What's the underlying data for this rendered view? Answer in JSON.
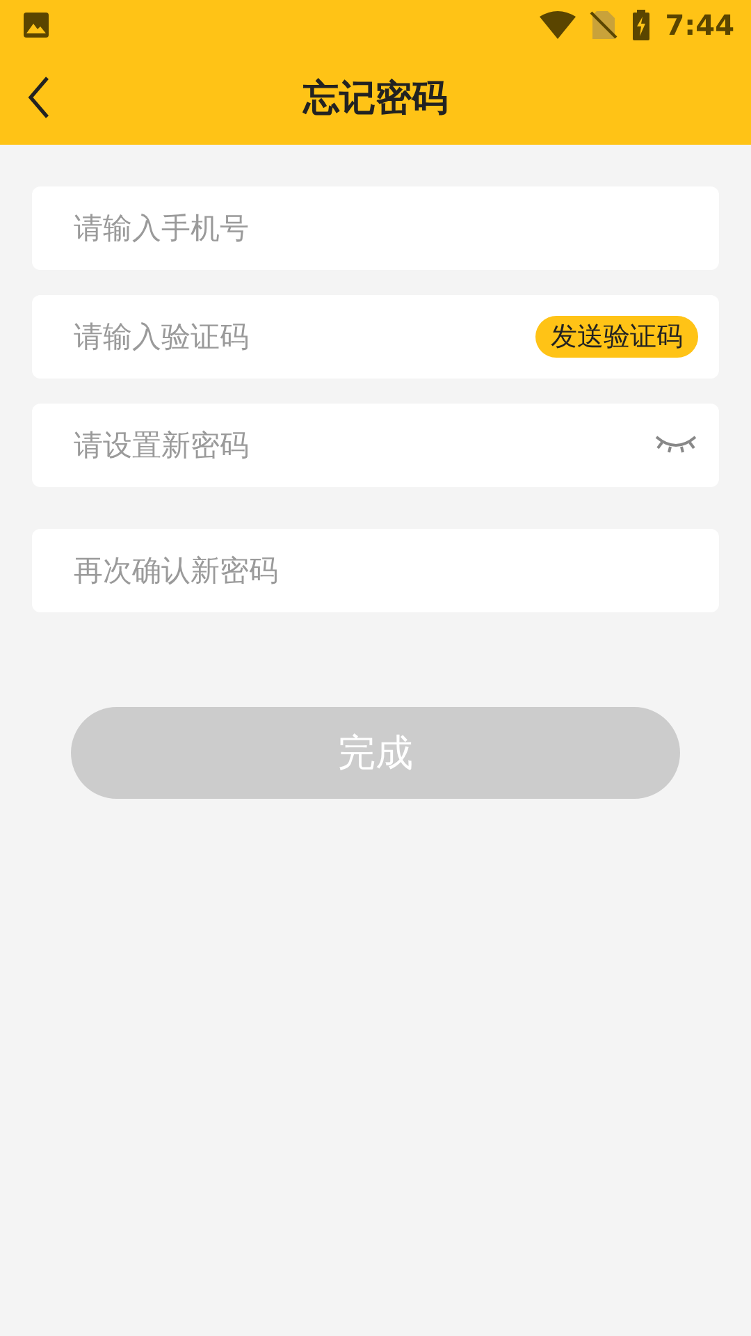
{
  "status_bar": {
    "time": "7:44"
  },
  "header": {
    "title": "忘记密码"
  },
  "fields": [
    {
      "kind": "plain",
      "placeholder": "请输入手机号"
    },
    {
      "kind": "code",
      "placeholder": "请输入验证码",
      "action": "发送验证码"
    },
    {
      "kind": "password",
      "placeholder": "请设置新密码",
      "visible": false
    },
    {
      "kind": "plain",
      "placeholder": "再次确认新密码"
    }
  ],
  "submit": {
    "label": "完成",
    "disabled": true
  }
}
